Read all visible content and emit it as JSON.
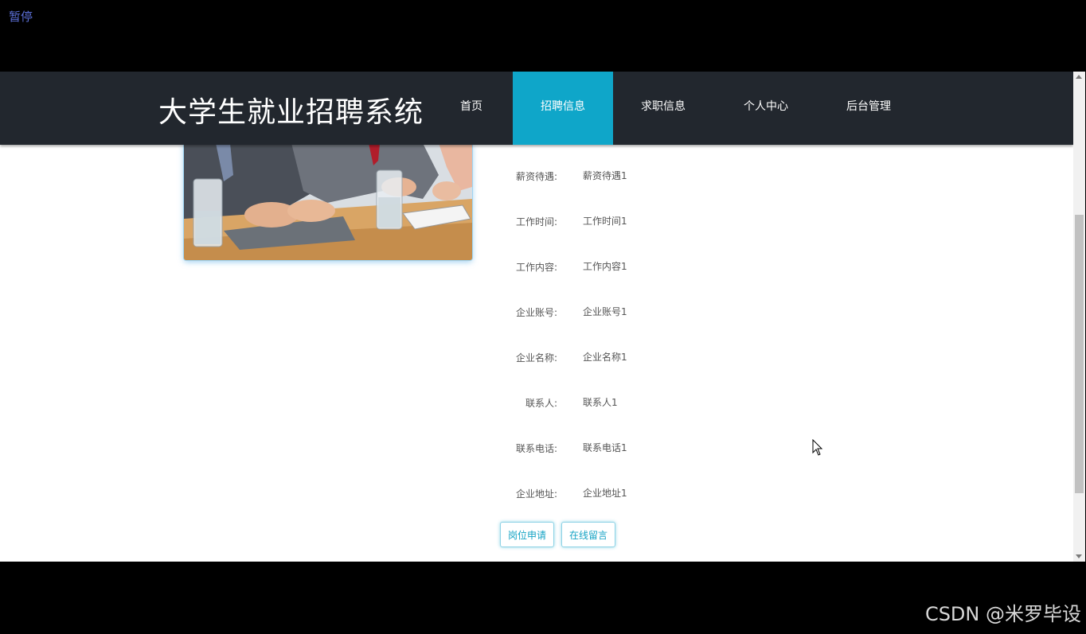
{
  "top_link": {
    "pause": "暂停"
  },
  "header": {
    "title": "大学生就业招聘系统",
    "nav": [
      {
        "label": "首页",
        "active": false
      },
      {
        "label": "招聘信息",
        "active": true
      },
      {
        "label": "求职信息",
        "active": false
      },
      {
        "label": "个人中心",
        "active": false
      },
      {
        "label": "后台管理",
        "active": false
      }
    ]
  },
  "details": [
    {
      "label": "薪资待遇:",
      "value": "薪资待遇1"
    },
    {
      "label": "工作时间:",
      "value": "工作时间1"
    },
    {
      "label": "工作内容:",
      "value": "工作内容1"
    },
    {
      "label": "企业账号:",
      "value": "企业账号1"
    },
    {
      "label": "企业名称:",
      "value": "企业名称1"
    },
    {
      "label": "联系人:",
      "value": "联系人1"
    },
    {
      "label": "联系电话:",
      "value": "联系电话1"
    },
    {
      "label": "企业地址:",
      "value": "企业地址1"
    }
  ],
  "actions": {
    "apply": "岗位申请",
    "message": "在线留言"
  },
  "watermark": "CSDN @米罗毕设",
  "colors": {
    "nav_bg": "#22272e",
    "accent": "#0fa6c9"
  }
}
